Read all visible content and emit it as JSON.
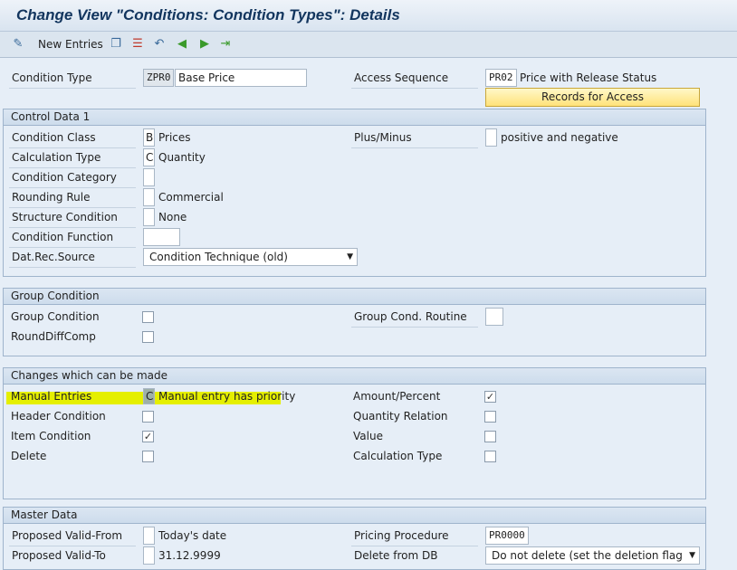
{
  "title": "Change View \"Conditions: Condition Types\": Details",
  "toolbar": {
    "new_entries": "New Entries",
    "icons": [
      "display-change-icon",
      "copy-icon",
      "delete-icon",
      "undo-icon",
      "previous-entry-icon",
      "next-entry-icon",
      "select-all-icon"
    ]
  },
  "header": {
    "condition_type_label": "Condition Type",
    "condition_type_value": "ZPR0",
    "condition_type_desc": "Base Price",
    "access_sequence_label": "Access Sequence",
    "access_sequence_value": "PR02",
    "access_sequence_desc": "Price with Release Status",
    "records_button": "Records for Access"
  },
  "control_data": {
    "title": "Control Data 1",
    "condition_class": {
      "label": "Condition Class",
      "value": "B",
      "desc": "Prices"
    },
    "calculation_type": {
      "label": "Calculation Type",
      "value": "C",
      "desc": "Quantity"
    },
    "condition_category": {
      "label": "Condition Category",
      "value": ""
    },
    "rounding_rule": {
      "label": "Rounding Rule",
      "value": "",
      "desc": "Commercial"
    },
    "structure_condition": {
      "label": "Structure Condition",
      "value": "",
      "desc": "None"
    },
    "condition_function": {
      "label": "Condition Function",
      "value": ""
    },
    "dat_rec_source": {
      "label": "Dat.Rec.Source",
      "value": "Condition Technique (old)"
    },
    "plus_minus": {
      "label": "Plus/Minus",
      "value": "",
      "desc": "positive and negative"
    }
  },
  "group_condition": {
    "title": "Group Condition",
    "group_condition_label": "Group Condition",
    "group_condition_checked": false,
    "round_diff_label": "RoundDiffComp",
    "round_diff_checked": false,
    "routine_label": "Group Cond. Routine",
    "routine_value": ""
  },
  "changes": {
    "title": "Changes which can be made",
    "manual_entries": {
      "label": "Manual Entries",
      "value": "C",
      "desc": "Manual entry has priority"
    },
    "header_condition": {
      "label": "Header Condition",
      "checked": false
    },
    "item_condition": {
      "label": "Item Condition",
      "checked": true
    },
    "delete": {
      "label": "Delete",
      "checked": false
    },
    "amount_percent": {
      "label": "Amount/Percent",
      "checked": true
    },
    "quantity_relation": {
      "label": "Quantity Relation",
      "checked": false
    },
    "value": {
      "label": "Value",
      "checked": false
    },
    "calculation_type": {
      "label": "Calculation Type",
      "checked": false
    },
    "highlight_color": "#e5ef00"
  },
  "master_data": {
    "title": "Master Data",
    "valid_from": {
      "label": "Proposed Valid-From",
      "value": "",
      "desc": "Today's date"
    },
    "valid_to": {
      "label": "Proposed Valid-To",
      "value": "",
      "desc": "31.12.9999"
    },
    "pricing_procedure": {
      "label": "Pricing Procedure",
      "value": "PR0000"
    },
    "delete_from_db": {
      "label": "Delete from DB",
      "value": "Do not delete (set the deletion flag"
    }
  }
}
